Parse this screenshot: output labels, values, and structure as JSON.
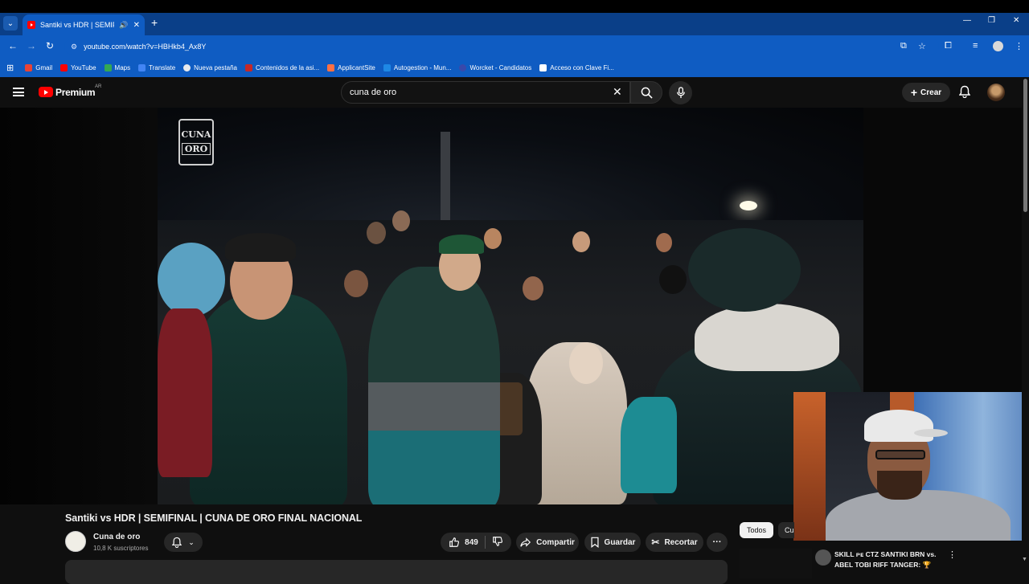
{
  "browser": {
    "tab_title": "Santiki vs HDR | SEMIFINAL",
    "new_tab": "+",
    "url": "youtube.com/watch?v=HBHkb4_Ax8Y",
    "bookmarks": [
      {
        "label": "Gmail",
        "color": "#ea4335"
      },
      {
        "label": "YouTube",
        "color": "#ff0000"
      },
      {
        "label": "Maps",
        "color": "#34a853"
      },
      {
        "label": "Translate",
        "color": "#4285f4"
      },
      {
        "label": "Nueva pestaña",
        "color": "#e8eaed"
      },
      {
        "label": "Contenidos de la asi...",
        "color": "#c62828"
      },
      {
        "label": "ApplicantSite",
        "color": "#ff7043"
      },
      {
        "label": "Autogestion - Mun...",
        "color": "#1e88e5"
      },
      {
        "label": "Worcket - Candidatos",
        "color": "#3949ab"
      },
      {
        "label": "Acceso con Clave Fi...",
        "color": "#ffffff"
      }
    ]
  },
  "youtube": {
    "brand": "Premium",
    "region": "AR",
    "search_value": "cuna de oro",
    "create_label": "Crear"
  },
  "video": {
    "watermark_line1": "CUNA",
    "watermark_line2": "ORO",
    "title": "Santiki vs HDR | SEMIFINAL | CUNA DE ORO FINAL NACIONAL",
    "channel": "Cuna de oro",
    "subscribers": "10,8 K suscriptores",
    "likes": "849",
    "share_label": "Compartir",
    "save_label": "Guardar",
    "clip_label": "Recortar"
  },
  "sidebar": {
    "chip_all": "Todos",
    "chip_partial": "Cu",
    "rec_title": "SKILL ᴘᴇ CTZ SANTIKI BRN vs. ABEL TOBI RIFF TANGER: 🏆"
  }
}
